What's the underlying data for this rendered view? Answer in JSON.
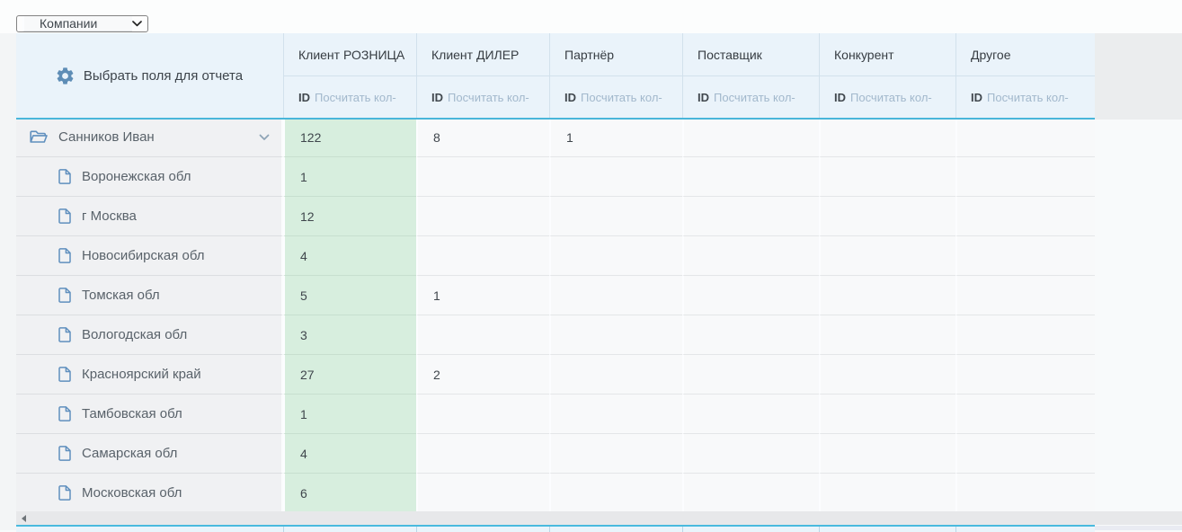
{
  "entity_selector": {
    "value": "Компании"
  },
  "report": {
    "fields_button": {
      "label": "Выбрать поля для отчета"
    },
    "columns": [
      {
        "label": "Клиент РОЗНИЦА",
        "highlighted": true
      },
      {
        "label": "Клиент ДИЛЕР",
        "highlighted": false
      },
      {
        "label": "Партнёр",
        "highlighted": false
      },
      {
        "label": "Поставщик",
        "highlighted": false
      },
      {
        "label": "Конкурент",
        "highlighted": false
      },
      {
        "label": "Другое",
        "highlighted": false
      }
    ],
    "subheader": {
      "id_label": "ID",
      "aggregate_label": "Посчитать кол-"
    },
    "rows": [
      {
        "label": "Санников Иван",
        "type": "group",
        "expanded": true,
        "values": [
          "122",
          "8",
          "1",
          "",
          "",
          ""
        ]
      },
      {
        "label": "Воронежская обл",
        "type": "item",
        "values": [
          "1",
          "",
          "",
          "",
          "",
          ""
        ]
      },
      {
        "label": "г Москва",
        "type": "item",
        "values": [
          "12",
          "",
          "",
          "",
          "",
          ""
        ]
      },
      {
        "label": "Новосибирская обл",
        "type": "item",
        "values": [
          "4",
          "",
          "",
          "",
          "",
          ""
        ]
      },
      {
        "label": "Томская обл",
        "type": "item",
        "values": [
          "5",
          "1",
          "",
          "",
          "",
          ""
        ]
      },
      {
        "label": "Вологодская обл",
        "type": "item",
        "values": [
          "3",
          "",
          "",
          "",
          "",
          ""
        ]
      },
      {
        "label": "Красноярский край",
        "type": "item",
        "values": [
          "27",
          "2",
          "",
          "",
          "",
          ""
        ]
      },
      {
        "label": "Тамбовская обл",
        "type": "item",
        "values": [
          "1",
          "",
          "",
          "",
          "",
          ""
        ]
      },
      {
        "label": "Самарская обл",
        "type": "item",
        "values": [
          "4",
          "",
          "",
          "",
          "",
          ""
        ]
      },
      {
        "label": "Московская обл",
        "type": "item",
        "values": [
          "6",
          "",
          "",
          "",
          "",
          ""
        ]
      }
    ]
  },
  "colors": {
    "header_bg": "#eaf3fa",
    "header_border": "#d2e1ec",
    "accent_border": "#49b6da",
    "highlight_green": "#d7eede",
    "row_label_bg": "#f0f1f3",
    "cell_bg": "#f8f9fa",
    "aggregate_link": "#a2b8cc",
    "icon_blue": "#5e8db6"
  }
}
